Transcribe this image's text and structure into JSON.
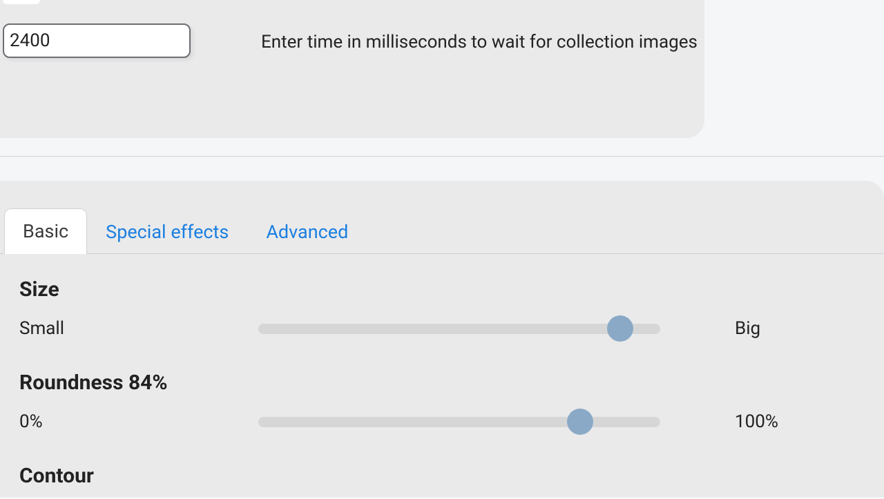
{
  "upper": {
    "wait_value": "2400",
    "wait_description": "Enter time in milliseconds to wait for collection images"
  },
  "tabs": {
    "basic": "Basic",
    "special_effects": "Special effects",
    "advanced": "Advanced"
  },
  "sections": {
    "size": {
      "title": "Size",
      "left": "Small",
      "right": "Big",
      "thumb_percent": 90
    },
    "roundness": {
      "title": "Roundness 84%",
      "left": "0%",
      "right": "100%",
      "thumb_percent": 80
    },
    "contour": {
      "title": "Contour"
    }
  }
}
